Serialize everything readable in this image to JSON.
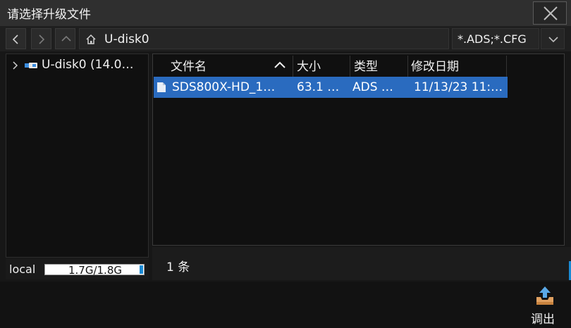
{
  "dialog": {
    "title": "请选择升级文件"
  },
  "nav": {
    "path": "U-disk0",
    "filter": "*.ADS;*.CFG"
  },
  "tree": {
    "items": [
      {
        "label": "U-disk0  (14.0…"
      }
    ]
  },
  "storage": {
    "label": "local",
    "usage": "1.7G/1.8G",
    "used_fraction": 0.94
  },
  "file_list": {
    "columns": [
      "文件名",
      "大小",
      "类型",
      "修改日期"
    ],
    "rows": [
      {
        "name": "SDS800X-HD_1…",
        "size": "63.1 …",
        "type": "ADS …",
        "modified": "11/13/23 11:…",
        "selected": true
      }
    ]
  },
  "status": {
    "count": "1 条"
  },
  "actions": {
    "export_label": "调出"
  },
  "colors": {
    "selection": "#2a6bbf",
    "accent": "#1a8ad4",
    "background": "#171717"
  }
}
